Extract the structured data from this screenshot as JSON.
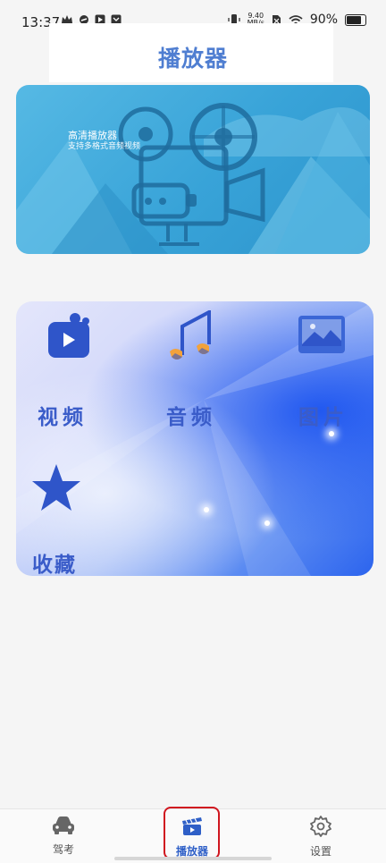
{
  "status_bar": {
    "time": "13:37",
    "net_speed_value": "9.40",
    "net_speed_unit": "MB/s",
    "battery": "90%"
  },
  "header": {
    "title": "播放器"
  },
  "banner": {
    "title": "高清播放器",
    "subtitle": "支持多格式音频视频"
  },
  "media": {
    "items": [
      {
        "label": "视频",
        "icon": "video-icon"
      },
      {
        "label": "音频",
        "icon": "music-note-icon"
      },
      {
        "label": "图片",
        "icon": "image-icon"
      },
      {
        "label": "收藏",
        "icon": "star-icon"
      }
    ]
  },
  "tabbar": {
    "tabs": [
      {
        "label": "驾考",
        "icon": "car-icon"
      },
      {
        "label": "播放器",
        "icon": "clapperboard-icon",
        "active": true
      },
      {
        "label": "设置",
        "icon": "gear-icon"
      }
    ]
  },
  "colors": {
    "accent": "#4f7ed1",
    "banner": "#38a3d8",
    "highlight": "#d0161f"
  }
}
